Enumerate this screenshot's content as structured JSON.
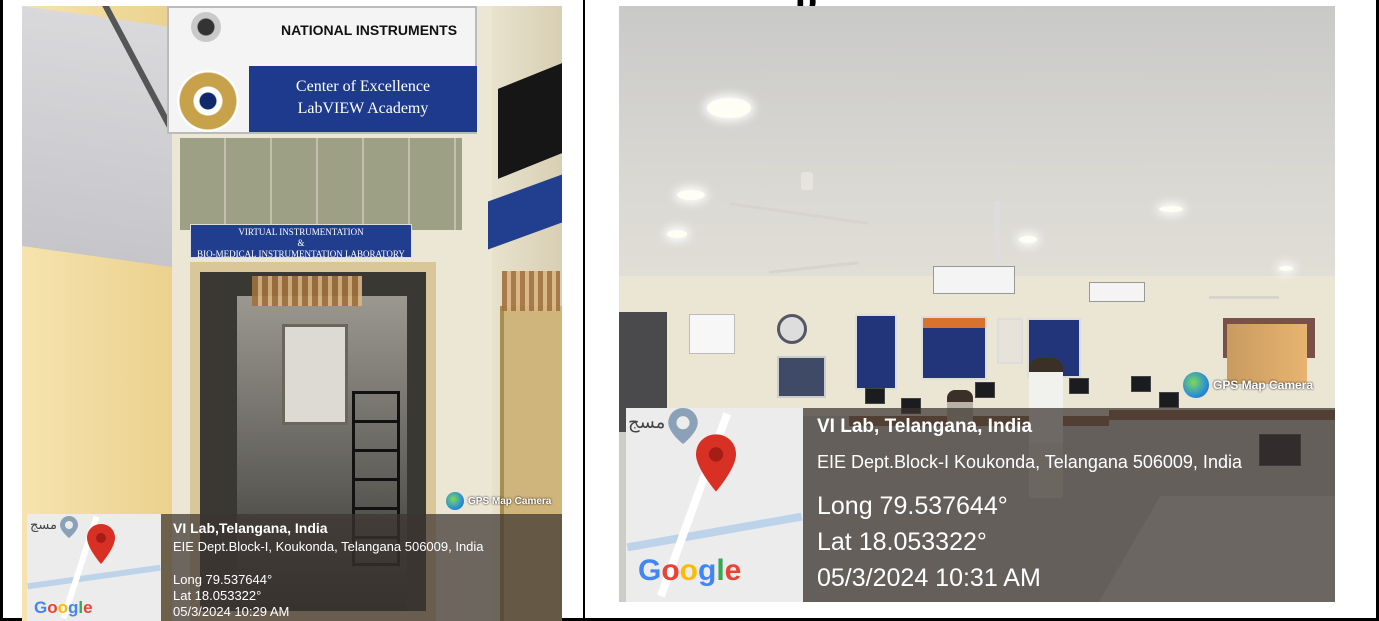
{
  "title_fragment": "p",
  "photos": [
    {
      "name": "left",
      "signs": {
        "brand": "NATIONAL INSTRUMENTS",
        "center_line1": "Center of Excellence",
        "center_line2": "LabVIEW Academy",
        "lab_line1": "VIRTUAL INSTRUMENTATION",
        "lab_line2": "&",
        "lab_line3": "BIO-MEDICAL INSTRUMENTATION LABORATORY"
      },
      "gps": {
        "title": "VI Lab,Telangana, India",
        "address": "EIE Dept.Block-I, Koukonda, Telangana 506009, India",
        "longitude": "Long 79.537644°",
        "latitude": "Lat 18.053322°",
        "timestamp": "05/3/2024 10:29 AM",
        "map_label": "مسج",
        "camera_badge": "GPS Map Camera",
        "map_brand": [
          "G",
          "o",
          "o",
          "g",
          "l",
          "e"
        ]
      }
    },
    {
      "name": "right",
      "gps": {
        "title": "VI Lab, Telangana, India",
        "address": "EIE Dept.Block-I Koukonda, Telangana 506009, India",
        "longitude": "Long 79.537644°",
        "latitude": "Lat 18.053322°",
        "timestamp": "05/3/2024 10:31 AM",
        "map_label": "مسج",
        "camera_badge": "GPS Map Camera",
        "map_brand": [
          "G",
          "o",
          "o",
          "g",
          "l",
          "e"
        ]
      }
    }
  ],
  "colors": {
    "sign_blue": "#1d3a8c",
    "pin_red": "#d93025",
    "overlay": "#3c3430"
  },
  "icons": [
    "map-pin-icon",
    "globe-icon",
    "seal-icon"
  ]
}
